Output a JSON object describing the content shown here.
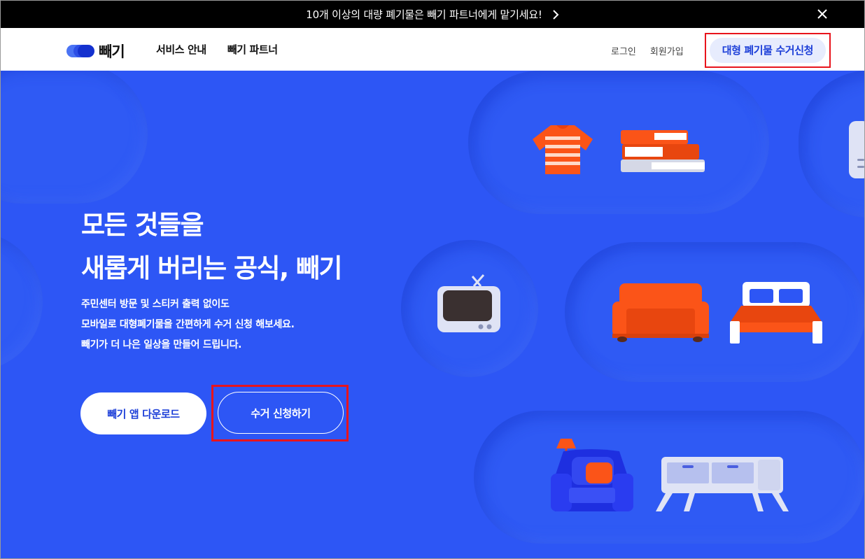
{
  "banner": {
    "message": "10개 이상의 대량 폐기물은 빼기 파트너에게 맡기세요!",
    "arrow_icon": "chevron-right-icon",
    "close_icon": "close-icon"
  },
  "header": {
    "logo_text": "빼기",
    "nav": [
      "서비스 안내",
      "빼기 파트너"
    ],
    "login": "로그인",
    "signup": "회원가입",
    "cta": "대형 폐기물 수거신청"
  },
  "hero": {
    "title_line1": "모든 것들을",
    "title_line2": "새롭게 버리는 공식, 빼기",
    "desc_line1": "주민센터 방문 및 스티커 출력 없이도",
    "desc_line2": "모바일로 대형폐기물을 간편하게 수거 신청 해보세요.",
    "desc_line3": "빼기가 더 나은 일상을 만들어 드립니다.",
    "btn_download": "빼기 앱 다운로드",
    "btn_apply": "수거 신청하기"
  },
  "illustrations": [
    "t-shirt-icon",
    "books-icon",
    "tv-icon",
    "sofa-icon",
    "bed-icon",
    "armchair-icon",
    "floor-lamp-icon",
    "cabinet-icon"
  ],
  "colors": {
    "hero_bg": "#2d56f5",
    "accent": "#1d3fd8",
    "highlight_box": "#e8141c",
    "furniture_orange": "#fb5418"
  }
}
